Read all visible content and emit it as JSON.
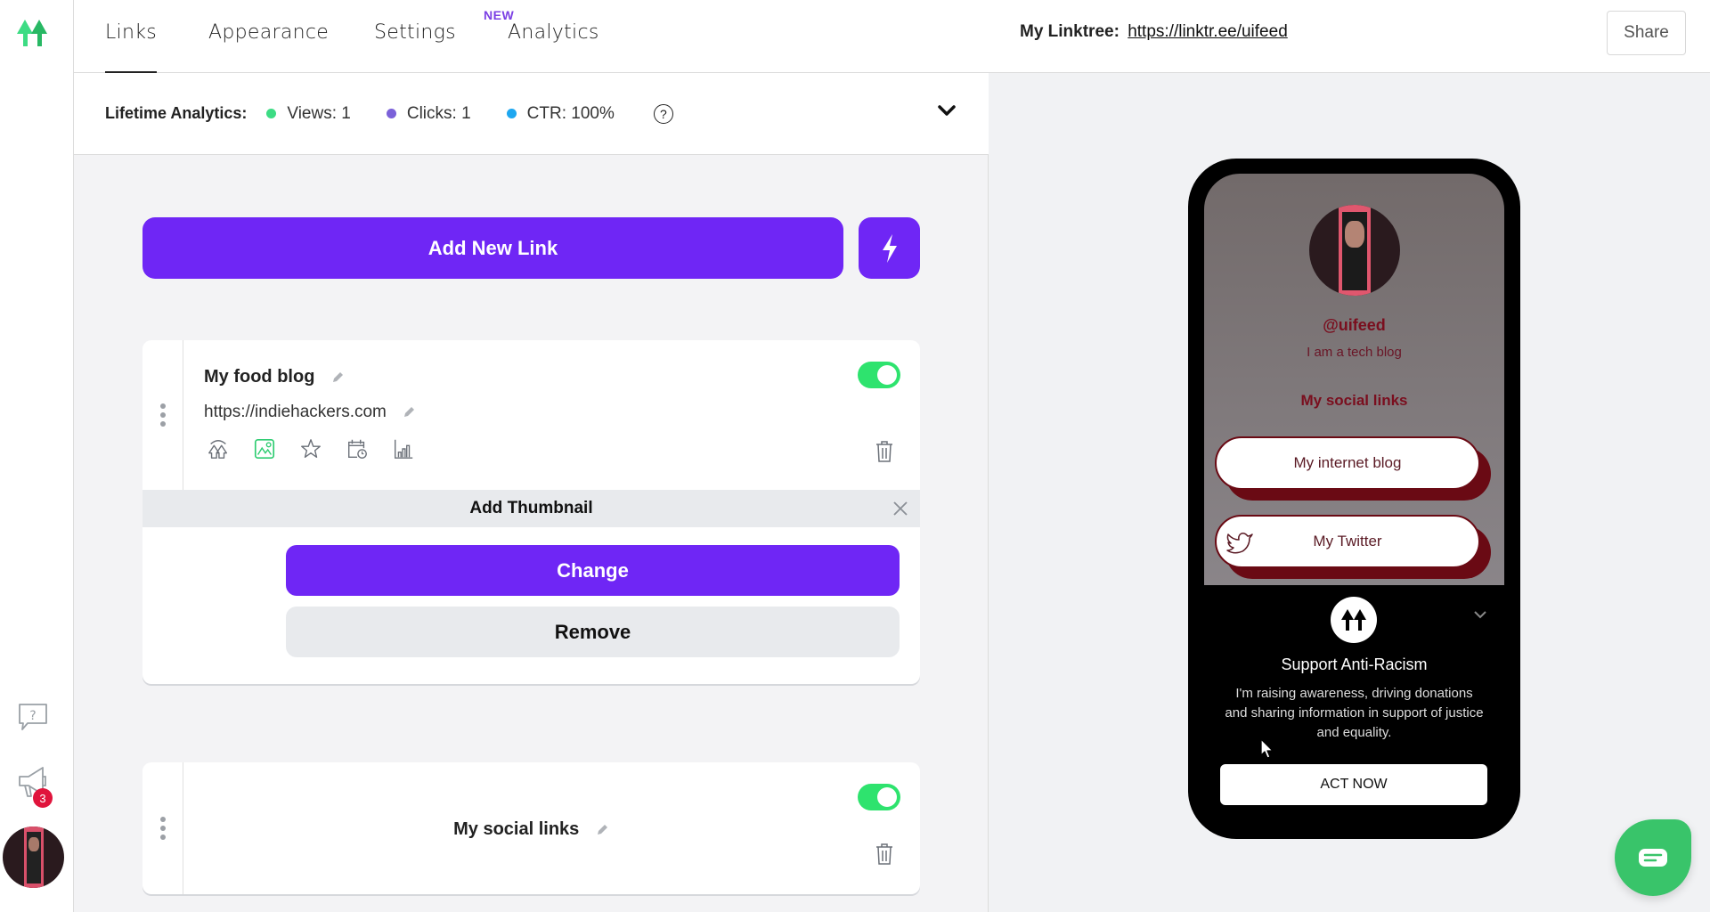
{
  "nav": {
    "tabs": [
      {
        "label": "Links",
        "active": true
      },
      {
        "label": "Appearance",
        "active": false
      },
      {
        "label": "Settings",
        "active": false
      },
      {
        "label": "Analytics",
        "active": false,
        "badge": "NEW"
      }
    ]
  },
  "analytics": {
    "label": "Lifetime Analytics:",
    "metrics": [
      {
        "label": "Views: 1",
        "color": "#3ddc84"
      },
      {
        "label": "Clicks: 1",
        "color": "#7b61d9"
      },
      {
        "label": "CTR: 100%",
        "color": "#1ea7f0"
      }
    ],
    "help_icon": "?"
  },
  "actions": {
    "add_link_label": "Add New Link",
    "bolt_icon": "lightning-icon"
  },
  "links": [
    {
      "title": "My food blog",
      "url": "https://indiehackers.com",
      "enabled": true,
      "tools": [
        "redirect-icon",
        "thumbnail-icon",
        "star-icon",
        "schedule-icon",
        "analytics-icon"
      ],
      "thumbnail_panel": {
        "title": "Add Thumbnail",
        "change_label": "Change",
        "remove_label": "Remove"
      }
    },
    {
      "title": "My social links",
      "enabled": true,
      "type": "header"
    }
  ],
  "sidebar": {
    "notification_count": "3"
  },
  "preview": {
    "my_linktree_label": "My Linktree:",
    "url": "https://linktr.ee/uifeed",
    "share_label": "Share",
    "profile": {
      "handle": "@uifeed",
      "bio": "I am a tech blog",
      "section_title": "My social links",
      "links": [
        "My internet blog",
        "My Twitter"
      ]
    },
    "banner": {
      "title": "Support Anti-Racism",
      "text": "I'm raising awareness, driving donations and sharing information in support of justice and equality.",
      "button": "ACT NOW"
    }
  },
  "colors": {
    "accent": "#6f26f5",
    "toggle_on": "#2ee36e",
    "brand_green": "#39c46a",
    "profile_text": "#7a0e1e"
  }
}
